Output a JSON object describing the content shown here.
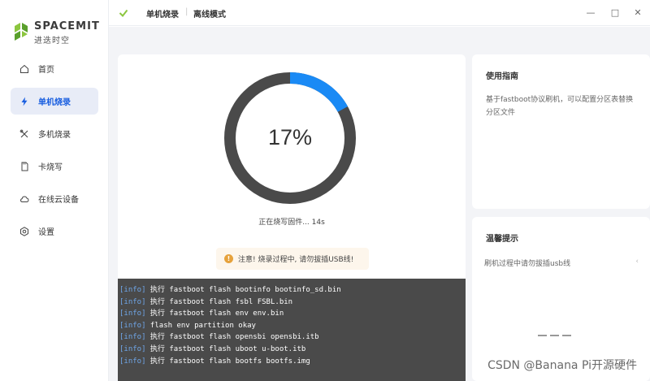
{
  "brand": {
    "name": "SPACEMIT",
    "subtitle": "进迭时空"
  },
  "titlebar": {
    "title": "单机烧录",
    "separator": "|",
    "mode": "离线模式"
  },
  "sidebar": {
    "items": [
      {
        "label": "首页",
        "icon": "home-icon",
        "active": false
      },
      {
        "label": "单机烧录",
        "icon": "lightning-icon",
        "active": true
      },
      {
        "label": "多机烧录",
        "icon": "tools-icon",
        "active": false
      },
      {
        "label": "卡烧写",
        "icon": "sd-card-icon",
        "active": false
      },
      {
        "label": "在线云设备",
        "icon": "cloud-icon",
        "active": false
      },
      {
        "label": "设置",
        "icon": "settings-icon",
        "active": false
      }
    ]
  },
  "progress": {
    "percent_label": "17%",
    "value": 0.17,
    "status": "正在烧写固件... 14s"
  },
  "warning": {
    "text": "注意! 烧录过程中, 请勿拔插USB线!"
  },
  "log": {
    "lines": [
      {
        "tag": "[info]",
        "text": " 执行 fastboot flash bootinfo bootinfo_sd.bin"
      },
      {
        "tag": "[info]",
        "text": " 执行 fastboot flash fsbl FSBL.bin"
      },
      {
        "tag": "[info]",
        "text": " 执行 fastboot flash env env.bin"
      },
      {
        "tag": "[info]",
        "text": " flash env partition okay"
      },
      {
        "tag": "[info]",
        "text": " 执行 fastboot flash opensbi opensbi.itb"
      },
      {
        "tag": "[info]",
        "text": " 执行 fastboot flash uboot u-boot.itb"
      },
      {
        "tag": "[info]",
        "text": " 执行 fastboot flash bootfs bootfs.img"
      }
    ]
  },
  "guide": {
    "title": "使用指南",
    "body": "基于fastboot协议刷机，可以配置分区表替换分区文件"
  },
  "tips": {
    "title": "温馨提示",
    "line": "刷机过程中请勿拔插usb线",
    "chevron": "‹"
  },
  "window_controls": {
    "minimize": "—",
    "maximize": "□",
    "close": "✕"
  },
  "watermark": "CSDN @Banana Pi开源硬件",
  "colors": {
    "accent": "#1a8af5",
    "ring_track": "#4a4a4a",
    "active_nav_bg": "#e8ecf7",
    "log_bg": "#4a4a4a",
    "log_tag": "#6fa6e8",
    "warning": "#e6a23c"
  }
}
